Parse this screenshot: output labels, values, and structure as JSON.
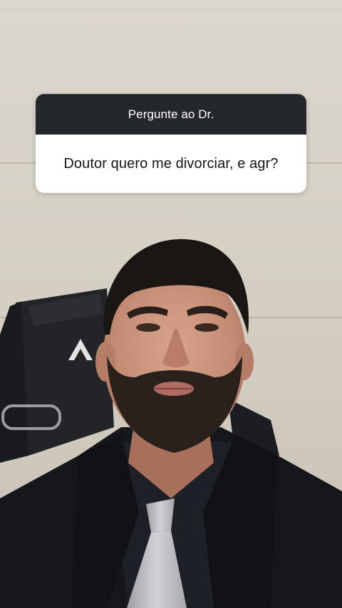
{
  "question_sticker": {
    "header": "Pergunte ao Dr.",
    "question": "Doutor quero me divorciar, e agr?"
  },
  "colors": {
    "sticker_header_bg": "#24272c",
    "sticker_body_bg": "#ffffff",
    "wall": "#d8d3ca",
    "suit": "#15171b",
    "tie": "#b9b9bd"
  }
}
